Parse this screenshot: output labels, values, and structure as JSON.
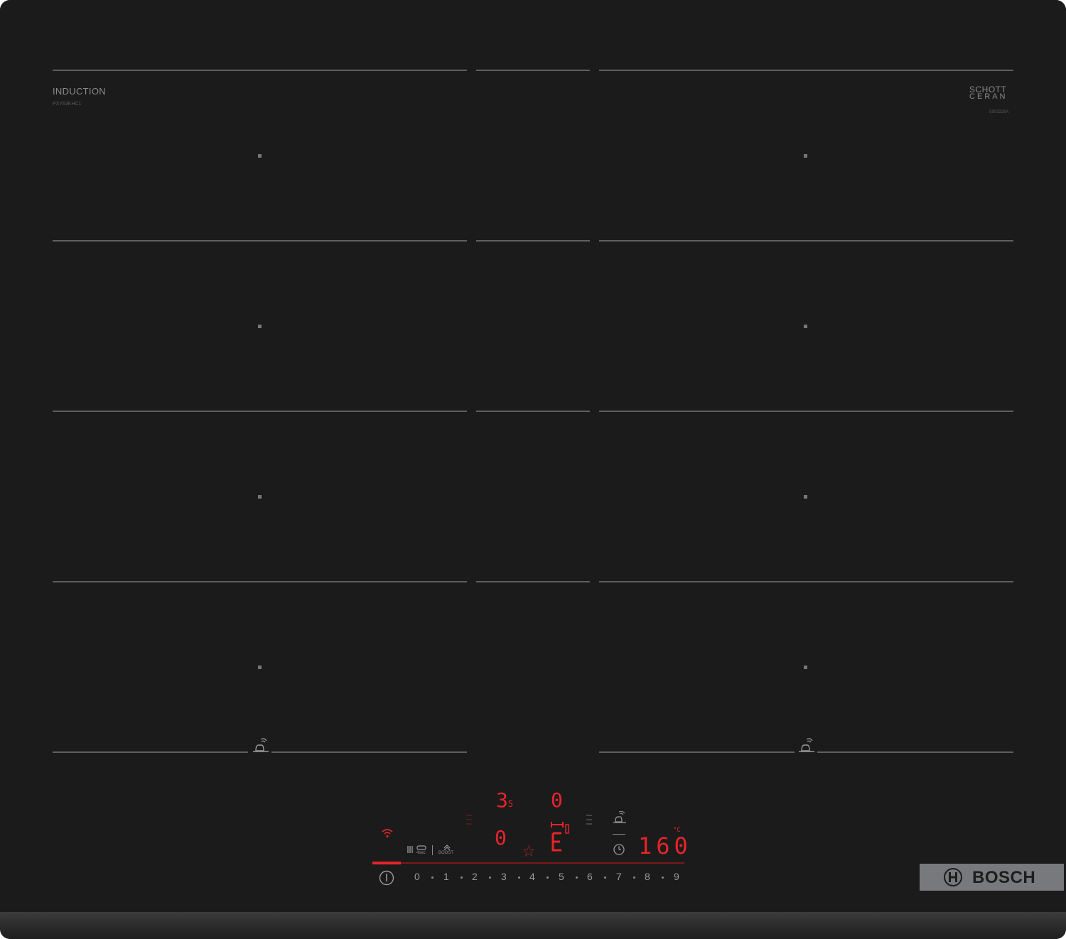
{
  "hob": {
    "type_label": "INDUCTION",
    "model_code": "PXY63KHC1",
    "glass_brand_line1": "SCHOTT",
    "glass_brand_line2": "CERAN",
    "glass_code": "5903226A"
  },
  "display": {
    "zone_left_top": "3",
    "zone_left_top_decimal": "5",
    "zone_right_top": "0",
    "zone_left_bottom": "0",
    "temperature_value": "160",
    "temperature_unit": "°C",
    "timer_label": "4sec",
    "boost_label": "BOOST"
  },
  "power_scale": [
    "0",
    "1",
    "2",
    "3",
    "4",
    "5",
    "6",
    "7",
    "8",
    "9"
  ],
  "brand": {
    "name": "BOSCH"
  },
  "colors": {
    "glass": "#1b1b1b",
    "display_red": "#e8242a",
    "line_grey": "#5f5f5f",
    "brand_plate": "#77797c"
  },
  "icons": [
    "power-icon",
    "wifi-icon",
    "pan-sensor-icon",
    "timer-icon",
    "star-icon",
    "boost-icon",
    "bosch-logo-icon"
  ]
}
